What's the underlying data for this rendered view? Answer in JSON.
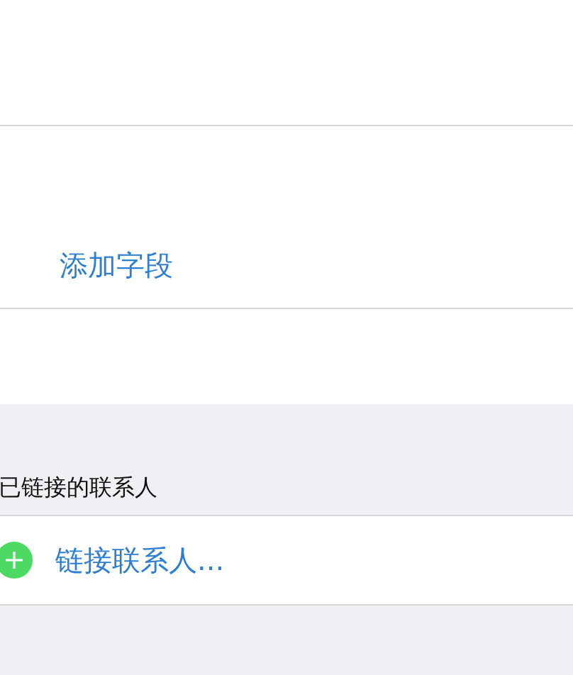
{
  "add_field": {
    "label": "添加字段"
  },
  "linked_contacts": {
    "header": "已链接的联系人",
    "link_action": {
      "label": "链接联系人..."
    }
  }
}
